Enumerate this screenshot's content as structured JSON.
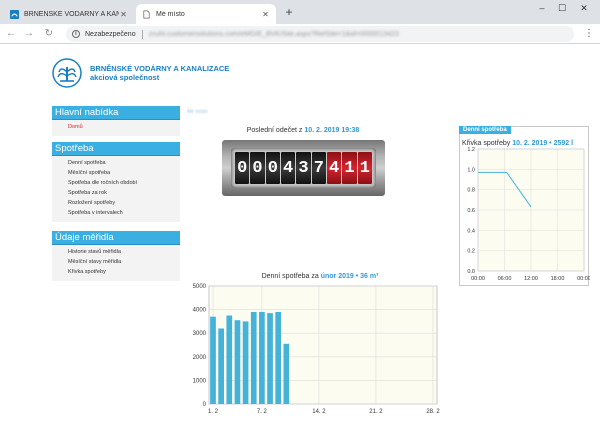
{
  "browser": {
    "tabs": [
      {
        "title": "BRNĚNSKÉ VODÁRNY A KANALIZACE",
        "active": false
      },
      {
        "title": "Mé místo",
        "active": true
      }
    ],
    "new_tab": "+",
    "window_controls": [
      "–",
      "☐",
      "✕"
    ],
    "address": {
      "security": "Nezabezpečeno",
      "url": "zcuhl.customersolutions.com/eMO/E_BVK/Site.aspx?RefSite=1&id=0000013423"
    }
  },
  "logo": {
    "line1": "BRNĚNSKÉ VODÁRNY A KANALIZACE",
    "line2": "akciová společnost"
  },
  "breadcrumb": "Mé místo",
  "sidebar": {
    "main": {
      "title": "Hlavní nabídka",
      "items": [
        {
          "label": "Domů"
        }
      ]
    },
    "consumption": {
      "title": "Spotřeba",
      "items": [
        {
          "label": "Denní spotřeba"
        },
        {
          "label": "Měsíční spotřeba"
        },
        {
          "label": "Spotřeba dle ročních období"
        },
        {
          "label": "Spotřeba za rok"
        },
        {
          "label": "Rozložení spotřeby"
        },
        {
          "label": "Spotřeba v intervalech"
        }
      ]
    },
    "meter": {
      "title": "Údaje měřidla",
      "items": [
        {
          "label": "Historie stavů měřidla"
        },
        {
          "label": "Měsíční stavy měřidla"
        },
        {
          "label": "Křivka spotřeby"
        }
      ]
    }
  },
  "counter": {
    "caption_prefix": "Poslední odečet z",
    "caption_date": "10. 2. 2019 19:38",
    "black_digits": [
      "0",
      "0",
      "0",
      "4",
      "3",
      "7"
    ],
    "red_digits": [
      "4",
      "1",
      "1"
    ]
  },
  "curve_panel": {
    "tag": "Denní spotřeba",
    "caption_prefix": "Křivka spotřeby",
    "caption_date": "10. 2. 2019",
    "caption_sep": " • ",
    "caption_value": "2592 l"
  },
  "daily_caption": {
    "prefix": "Denní spotřeba za",
    "month": "únor 2019",
    "sep": " • ",
    "value": "36 m³"
  },
  "colors": {
    "accent": "#3ab0e2",
    "bar": "#45b3d9",
    "grid_bg": "#fdfcf0",
    "red_digit": "#d2262e"
  },
  "chart_data": [
    {
      "type": "bar",
      "x_ticks": [
        "1. 2",
        "7. 2",
        "14. 2",
        "21. 2",
        "28. 2"
      ],
      "y_ticks": [
        0,
        1000,
        2000,
        3000,
        4000,
        5000
      ],
      "ylim": [
        0,
        5000
      ],
      "x_day_range": [
        1,
        28
      ],
      "days": [
        1,
        2,
        3,
        4,
        5,
        6,
        7,
        8,
        9,
        10
      ],
      "values": [
        3700,
        3200,
        3750,
        3550,
        3500,
        3900,
        3900,
        3850,
        3900,
        2550
      ],
      "grid": true
    },
    {
      "type": "line",
      "x_ticks": [
        "00:00",
        "06:00",
        "12:00",
        "18:00",
        "00:00"
      ],
      "y_ticks": [
        "0.0",
        "0.2",
        "0.4",
        "0.6",
        "0.8",
        "1.0",
        "1.2"
      ],
      "xlim": [
        0,
        24
      ],
      "ylim": [
        0,
        1.2
      ],
      "x": [
        0,
        6.5,
        12
      ],
      "y": [
        0.97,
        0.97,
        0.63
      ],
      "grid": true
    }
  ]
}
